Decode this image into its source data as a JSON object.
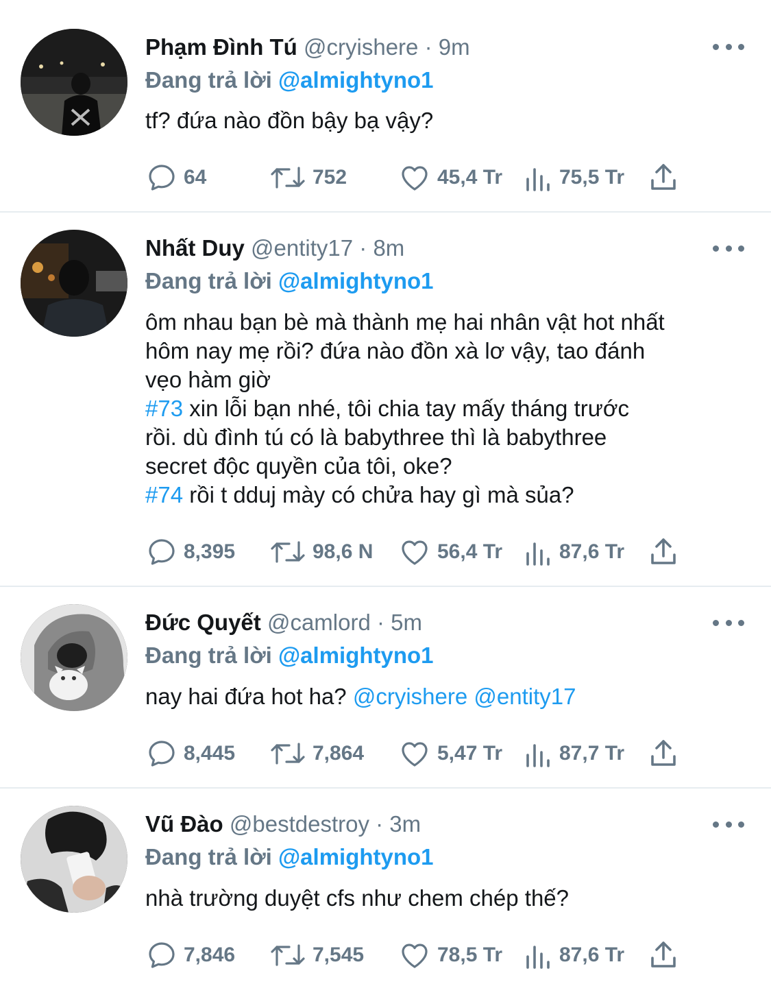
{
  "tweets": [
    {
      "name": "Phạm Đình Tú",
      "handle": "@cryishere",
      "sep": "·",
      "time": "9m",
      "reply_label": "Đang trả lời",
      "reply_target": "@almightyno1",
      "body_lines": [
        "tf? đứa nào đồn bậy bạ vậy?"
      ],
      "replies": "64",
      "retweets": "752",
      "likes": "45,4 Tr",
      "views": "75,5 Tr"
    },
    {
      "name": "Nhất Duy",
      "handle": "@entity17",
      "sep": "·",
      "time": "8m",
      "reply_label": "Đang trả lời",
      "reply_target": "@almightyno1",
      "body_lines": [
        "ôm nhau bạn bè mà thành mẹ hai nhân vật hot nhất",
        "hôm nay mẹ rồi? đứa nào đồn xà lơ vậy, tao đánh",
        "vẹo hàm giờ"
      ],
      "hashtag1": "#73",
      "hashtag1_lines": [
        " xin lỗi bạn nhé, tôi chia tay mấy tháng trước",
        "rồi. dù đình tú có là babythree thì là babythree",
        "secret độc quyền của tôi, oke?"
      ],
      "hashtag2": "#74",
      "hashtag2_text": " rồi t dduj mày có chửa hay gì mà sủa?",
      "replies": "8,395",
      "retweets": "98,6 N",
      "likes": "56,4 Tr",
      "views": "87,6 Tr"
    },
    {
      "name": "Đức Quyết",
      "handle": "@camlord",
      "sep": "·",
      "time": "5m",
      "reply_label": "Đang trả lời",
      "reply_target": "@almightyno1",
      "body_prefix": "nay hai đứa hot ha? ",
      "mention1": "@cryishere",
      "mention2": "@entity17",
      "replies": "8,445",
      "retweets": "7,864",
      "likes": "5,47 Tr",
      "views": "87,7 Tr"
    },
    {
      "name": "Vũ Đào",
      "handle": "@bestdestroy",
      "sep": "·",
      "time": "3m",
      "reply_label": "Đang trả lời",
      "reply_target": "@almightyno1",
      "body_lines": [
        "nhà trường duyệt cfs như chem chép thế?"
      ],
      "replies": "7,846",
      "retweets": "7,545",
      "likes": "78,5 Tr",
      "views": "87,6 Tr"
    }
  ],
  "icons": {
    "reply": "reply-icon",
    "retweet": "retweet-icon",
    "like": "heart-icon",
    "views": "views-icon",
    "share": "share-icon",
    "more": "more-icon"
  },
  "colors": {
    "accent": "#1d9bf0",
    "muted": "#657786",
    "text": "#14171a",
    "divider": "#e6ecf0"
  }
}
